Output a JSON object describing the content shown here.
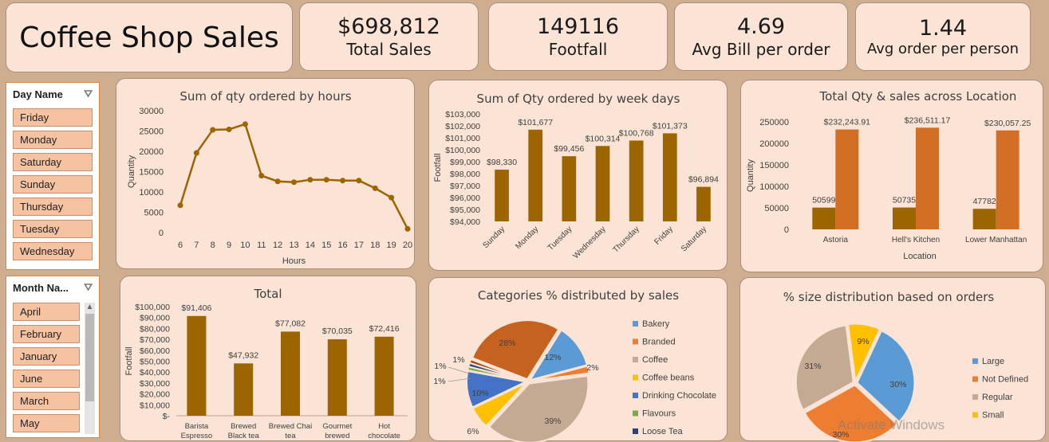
{
  "header": {
    "title": "Coffee Shop Sales"
  },
  "kpis": [
    {
      "value": "$698,812",
      "label": "Total Sales"
    },
    {
      "value": "149116",
      "label": "Footfall"
    },
    {
      "value": "4.69",
      "label": "Avg Bill per order"
    },
    {
      "value": "1.44",
      "label": "Avg order per person"
    }
  ],
  "slicers": {
    "day": {
      "title": "Day Name",
      "items": [
        "Friday",
        "Monday",
        "Saturday",
        "Sunday",
        "Thursday",
        "Tuesday",
        "Wednesday"
      ]
    },
    "month": {
      "title": "Month Na...",
      "items": [
        "April",
        "February",
        "January",
        "June",
        "March",
        "May"
      ]
    }
  },
  "colors": {
    "bar": "#9c6500",
    "orange": "#d26f25",
    "blue": "#5b9bd5",
    "gray": "#c5aa93",
    "yellow": "#ffc000",
    "green": "#70ad47",
    "darkblue": "#264478",
    "mid_blue": "#4472c4"
  },
  "watermark": "Activate Windows",
  "chart_data": [
    {
      "id": "hours",
      "type": "line",
      "title": "Sum of qty ordered by hours",
      "xlabel": "Hours",
      "ylabel": "Quantity",
      "x": [
        "6",
        "7",
        "8",
        "9",
        "10",
        "11",
        "12",
        "13",
        "14",
        "15",
        "16",
        "17",
        "18",
        "19",
        "20"
      ],
      "values": [
        6700,
        19600,
        25300,
        25400,
        26700,
        14000,
        12600,
        12400,
        13000,
        13000,
        12800,
        12800,
        10900,
        8600,
        900
      ],
      "ylim": [
        0,
        30000
      ],
      "yticks": [
        "0",
        "5000",
        "10000",
        "15000",
        "20000",
        "25000",
        "30000"
      ]
    },
    {
      "id": "weekdays",
      "type": "bar",
      "title": "Sum of Qty ordered by week days",
      "xlabel": "",
      "ylabel": "Footfall",
      "categories": [
        "Sunday",
        "Monday",
        "Tuesday",
        "Wednesday",
        "Thursday",
        "Friday",
        "Saturday"
      ],
      "values": [
        98330,
        101677,
        99456,
        100314,
        100768,
        101373,
        96894
      ],
      "labels": [
        "$98,330",
        "$101,677",
        "$99,456",
        "$100,314",
        "$100,768",
        "$101,373",
        "$96,894"
      ],
      "ylim": [
        94000,
        103000
      ],
      "yticks": [
        "$94,000",
        "$95,000",
        "$96,000",
        "$97,000",
        "$98,000",
        "$99,000",
        "$100,000",
        "$101,000",
        "$102,000",
        "$103,000"
      ]
    },
    {
      "id": "location",
      "type": "bar",
      "title": "Total Qty & sales across Location",
      "xlabel": "Location",
      "ylabel": "Quantity",
      "categories": [
        "Astoria",
        "Hell's Kitchen",
        "Lower Manhattan"
      ],
      "series": [
        {
          "values": [
            50599,
            50735,
            47782
          ],
          "labels": [
            "50599",
            "50735",
            "47782"
          ]
        },
        {
          "values": [
            232243.91,
            236511.17,
            230057.25
          ],
          "labels": [
            "$232,243.91",
            "$236,511.17",
            "$230,057.25"
          ]
        }
      ],
      "ylim": [
        0,
        250000
      ],
      "yticks": [
        "0",
        "50000",
        "100000",
        "150000",
        "200000",
        "250000"
      ]
    },
    {
      "id": "total",
      "type": "bar",
      "title": "Total",
      "xlabel": "",
      "ylabel": "Footfall",
      "categories": [
        "Barista Espresso",
        "Brewed Black tea",
        "Brewed Chai tea",
        "Gourmet brewed",
        "Hot chocolate"
      ],
      "category_lines": [
        [
          "Barista",
          "Espresso"
        ],
        [
          "Brewed",
          "Black tea"
        ],
        [
          "Brewed Chai",
          "tea"
        ],
        [
          "Gourmet",
          "brewed"
        ],
        [
          "Hot",
          "chocolate"
        ]
      ],
      "values": [
        91406,
        47932,
        77082,
        70035,
        72416
      ],
      "labels": [
        "$91,406",
        "$47,932",
        "$77,082",
        "$70,035",
        "$72,416"
      ],
      "ylim": [
        0,
        100000
      ],
      "yticks": [
        "$-",
        "$10,000",
        "$20,000",
        "$30,000",
        "$40,000",
        "$50,000",
        "$60,000",
        "$70,000",
        "$80,000",
        "$90,000",
        "$100,000"
      ]
    },
    {
      "id": "categories",
      "type": "pie",
      "title": "Categories % distributed by sales",
      "legend": [
        "Bakery",
        "Branded",
        "Coffee",
        "Coffee beans",
        "Drinking Chocolate",
        "Flavours",
        "Loose Tea"
      ],
      "slice_values": [
        12,
        2,
        39,
        6,
        10,
        1,
        1,
        1,
        28
      ],
      "slice_labels": [
        "12%",
        "2%",
        "39%",
        "6%",
        "10%",
        "1%",
        "1%",
        "1%",
        "28%"
      ],
      "slice_colors": [
        "#5b9bd5",
        "#ed7d31",
        "#c5aa93",
        "#ffc000",
        "#4472c4",
        "#70ad47",
        "#264478",
        "#9e480e",
        "#c5621f"
      ]
    },
    {
      "id": "sizes",
      "type": "pie",
      "title": "% size distribution based on orders",
      "legend": [
        "Large",
        "Not Defined",
        "Regular",
        "Small"
      ],
      "slice_values": [
        30,
        30,
        31,
        9
      ],
      "slice_labels": [
        "30%",
        "30%",
        "31%",
        "9%"
      ],
      "slice_colors": [
        "#5b9bd5",
        "#ed7d31",
        "#c5aa93",
        "#ffc000"
      ]
    }
  ]
}
